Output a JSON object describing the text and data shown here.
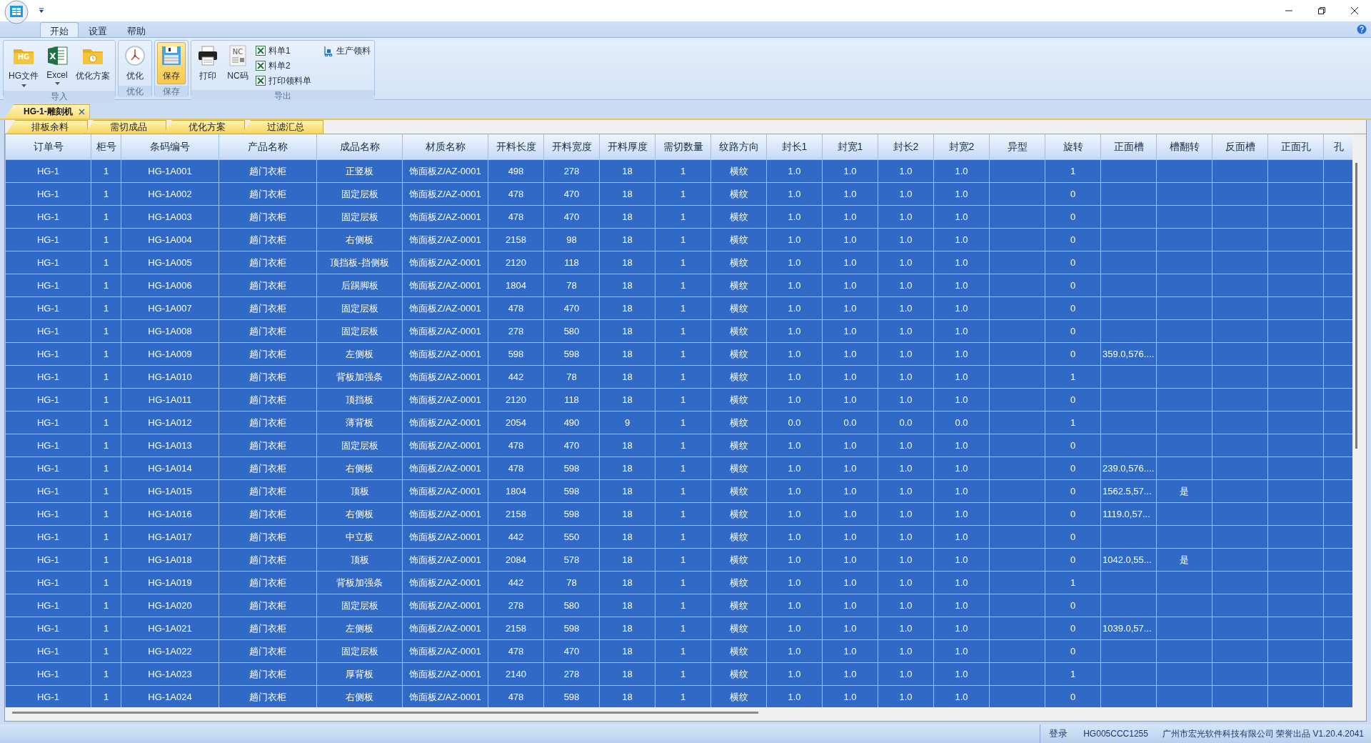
{
  "ribbon": {
    "tabs": [
      {
        "label": "开始",
        "selected": true
      },
      {
        "label": "设置",
        "selected": false
      },
      {
        "label": "帮助",
        "selected": false
      }
    ],
    "groups": [
      {
        "label": "导入",
        "buttons": [
          {
            "label": "HG文件",
            "kind": "large",
            "icon_text": "HG",
            "dropdown": true
          },
          {
            "label": "Excel",
            "kind": "large",
            "icon_text": "X",
            "dropdown": true
          },
          {
            "label": "优化方案",
            "kind": "large",
            "dropdown": false
          }
        ]
      },
      {
        "label": "优化",
        "buttons": [
          {
            "label": "优化",
            "kind": "large",
            "dropdown": false
          }
        ]
      },
      {
        "label": "保存",
        "buttons": [
          {
            "label": "保存",
            "kind": "large",
            "dropdown": false,
            "highlighted": true
          }
        ]
      },
      {
        "label": "导出",
        "buttons": [
          {
            "label": "打印",
            "kind": "large",
            "dropdown": false
          },
          {
            "label": "NC码",
            "kind": "large",
            "icon_text": "NC",
            "dropdown": false
          },
          {
            "label": "料单1",
            "kind": "small"
          },
          {
            "label": "料单2",
            "kind": "small"
          },
          {
            "label": "打印领料单",
            "kind": "small"
          },
          {
            "label": "生产领料",
            "kind": "small"
          }
        ]
      }
    ]
  },
  "doc_tabs": [
    {
      "label": "HG-1-雕刻机",
      "selected": true
    }
  ],
  "sub_tabs": [
    "排板余料",
    "需切成品",
    "优化方案",
    "过滤汇总"
  ],
  "table": {
    "columns": [
      "订单号",
      "柜号",
      "条码编号",
      "产品名称",
      "成品名称",
      "材质名称",
      "开料长度",
      "开料宽度",
      "开料厚度",
      "需切数量",
      "纹路方向",
      "封长1",
      "封宽1",
      "封长2",
      "封宽2",
      "异型",
      "旋转",
      "正面槽",
      "槽翻转",
      "反面槽",
      "正面孔",
      "孔"
    ],
    "rows": [
      {
        "cells": [
          "HG-1",
          "1",
          "HG-1A001",
          "趟门衣柜",
          "正竖板",
          "饰面板Z/AZ-0001",
          "498",
          "278",
          "18",
          "1",
          "横纹",
          "1.0",
          "1.0",
          "1.0",
          "1.0"
        ],
        "rotation": "1"
      },
      {
        "cells": [
          "HG-1",
          "1",
          "HG-1A002",
          "趟门衣柜",
          "固定层板",
          "饰面板Z/AZ-0001",
          "478",
          "470",
          "18",
          "1",
          "横纹",
          "1.0",
          "1.0",
          "1.0",
          "1.0"
        ],
        "rotation": "0"
      },
      {
        "cells": [
          "HG-1",
          "1",
          "HG-1A003",
          "趟门衣柜",
          "固定层板",
          "饰面板Z/AZ-0001",
          "478",
          "470",
          "18",
          "1",
          "横纹",
          "1.0",
          "1.0",
          "1.0",
          "1.0"
        ],
        "rotation": "0"
      },
      {
        "cells": [
          "HG-1",
          "1",
          "HG-1A004",
          "趟门衣柜",
          "右侧板",
          "饰面板Z/AZ-0001",
          "2158",
          "98",
          "18",
          "1",
          "横纹",
          "1.0",
          "1.0",
          "1.0",
          "1.0"
        ],
        "rotation": "0"
      },
      {
        "cells": [
          "HG-1",
          "1",
          "HG-1A005",
          "趟门衣柜",
          "顶挡板-挡侧板",
          "饰面板Z/AZ-0001",
          "2120",
          "118",
          "18",
          "1",
          "横纹",
          "1.0",
          "1.0",
          "1.0",
          "1.0"
        ],
        "rotation": "0"
      },
      {
        "cells": [
          "HG-1",
          "1",
          "HG-1A006",
          "趟门衣柜",
          "后踢脚板",
          "饰面板Z/AZ-0001",
          "1804",
          "78",
          "18",
          "1",
          "横纹",
          "1.0",
          "1.0",
          "1.0",
          "1.0"
        ],
        "rotation": "0"
      },
      {
        "cells": [
          "HG-1",
          "1",
          "HG-1A007",
          "趟门衣柜",
          "固定层板",
          "饰面板Z/AZ-0001",
          "478",
          "470",
          "18",
          "1",
          "横纹",
          "1.0",
          "1.0",
          "1.0",
          "1.0"
        ],
        "rotation": "0"
      },
      {
        "cells": [
          "HG-1",
          "1",
          "HG-1A008",
          "趟门衣柜",
          "固定层板",
          "饰面板Z/AZ-0001",
          "278",
          "580",
          "18",
          "1",
          "横纹",
          "1.0",
          "1.0",
          "1.0",
          "1.0"
        ],
        "rotation": "0"
      },
      {
        "cells": [
          "HG-1",
          "1",
          "HG-1A009",
          "趟门衣柜",
          "左侧板",
          "饰面板Z/AZ-0001",
          "598",
          "598",
          "18",
          "1",
          "横纹",
          "1.0",
          "1.0",
          "1.0",
          "1.0"
        ],
        "rotation": "0",
        "front_groove": "359.0,576...."
      },
      {
        "cells": [
          "HG-1",
          "1",
          "HG-1A010",
          "趟门衣柜",
          "背板加强条",
          "饰面板Z/AZ-0001",
          "442",
          "78",
          "18",
          "1",
          "横纹",
          "1.0",
          "1.0",
          "1.0",
          "1.0"
        ],
        "rotation": "1"
      },
      {
        "cells": [
          "HG-1",
          "1",
          "HG-1A011",
          "趟门衣柜",
          "顶挡板",
          "饰面板Z/AZ-0001",
          "2120",
          "118",
          "18",
          "1",
          "横纹",
          "1.0",
          "1.0",
          "1.0",
          "1.0"
        ],
        "rotation": "0"
      },
      {
        "cells": [
          "HG-1",
          "1",
          "HG-1A012",
          "趟门衣柜",
          "薄背板",
          "饰面板Z/AZ-0001",
          "2054",
          "490",
          "9",
          "1",
          "横纹",
          "0.0",
          "0.0",
          "0.0",
          "0.0"
        ],
        "rotation": "1"
      },
      {
        "cells": [
          "HG-1",
          "1",
          "HG-1A013",
          "趟门衣柜",
          "固定层板",
          "饰面板Z/AZ-0001",
          "478",
          "470",
          "18",
          "1",
          "横纹",
          "1.0",
          "1.0",
          "1.0",
          "1.0"
        ],
        "rotation": "0"
      },
      {
        "cells": [
          "HG-1",
          "1",
          "HG-1A014",
          "趟门衣柜",
          "右侧板",
          "饰面板Z/AZ-0001",
          "478",
          "598",
          "18",
          "1",
          "横纹",
          "1.0",
          "1.0",
          "1.0",
          "1.0"
        ],
        "rotation": "0",
        "front_groove": "239.0,576...."
      },
      {
        "cells": [
          "HG-1",
          "1",
          "HG-1A015",
          "趟门衣柜",
          "顶板",
          "饰面板Z/AZ-0001",
          "1804",
          "598",
          "18",
          "1",
          "横纹",
          "1.0",
          "1.0",
          "1.0",
          "1.0"
        ],
        "rotation": "0",
        "front_groove": "1562.5,57...",
        "groove_flip": "是"
      },
      {
        "cells": [
          "HG-1",
          "1",
          "HG-1A016",
          "趟门衣柜",
          "右侧板",
          "饰面板Z/AZ-0001",
          "2158",
          "598",
          "18",
          "1",
          "横纹",
          "1.0",
          "1.0",
          "1.0",
          "1.0"
        ],
        "rotation": "0",
        "front_groove": "1119.0,57..."
      },
      {
        "cells": [
          "HG-1",
          "1",
          "HG-1A017",
          "趟门衣柜",
          "中立板",
          "饰面板Z/AZ-0001",
          "442",
          "550",
          "18",
          "1",
          "横纹",
          "1.0",
          "1.0",
          "1.0",
          "1.0"
        ],
        "rotation": "0"
      },
      {
        "cells": [
          "HG-1",
          "1",
          "HG-1A018",
          "趟门衣柜",
          "顶板",
          "饰面板Z/AZ-0001",
          "2084",
          "578",
          "18",
          "1",
          "横纹",
          "1.0",
          "1.0",
          "1.0",
          "1.0"
        ],
        "rotation": "0",
        "front_groove": "1042.0,55...",
        "groove_flip": "是"
      },
      {
        "cells": [
          "HG-1",
          "1",
          "HG-1A019",
          "趟门衣柜",
          "背板加强条",
          "饰面板Z/AZ-0001",
          "442",
          "78",
          "18",
          "1",
          "横纹",
          "1.0",
          "1.0",
          "1.0",
          "1.0"
        ],
        "rotation": "1"
      },
      {
        "cells": [
          "HG-1",
          "1",
          "HG-1A020",
          "趟门衣柜",
          "固定层板",
          "饰面板Z/AZ-0001",
          "278",
          "580",
          "18",
          "1",
          "横纹",
          "1.0",
          "1.0",
          "1.0",
          "1.0"
        ],
        "rotation": "0"
      },
      {
        "cells": [
          "HG-1",
          "1",
          "HG-1A021",
          "趟门衣柜",
          "左侧板",
          "饰面板Z/AZ-0001",
          "2158",
          "598",
          "18",
          "1",
          "横纹",
          "1.0",
          "1.0",
          "1.0",
          "1.0"
        ],
        "rotation": "0",
        "front_groove": "1039.0,57..."
      },
      {
        "cells": [
          "HG-1",
          "1",
          "HG-1A022",
          "趟门衣柜",
          "固定层板",
          "饰面板Z/AZ-0001",
          "478",
          "470",
          "18",
          "1",
          "横纹",
          "1.0",
          "1.0",
          "1.0",
          "1.0"
        ],
        "rotation": "0"
      },
      {
        "cells": [
          "HG-1",
          "1",
          "HG-1A023",
          "趟门衣柜",
          "厚背板",
          "饰面板Z/AZ-0001",
          "2140",
          "278",
          "18",
          "1",
          "横纹",
          "1.0",
          "1.0",
          "1.0",
          "1.0"
        ],
        "rotation": "1"
      },
      {
        "cells": [
          "HG-1",
          "1",
          "HG-1A024",
          "趟门衣柜",
          "右侧板",
          "饰面板Z/AZ-0001",
          "478",
          "598",
          "18",
          "1",
          "横纹",
          "1.0",
          "1.0",
          "1.0",
          "1.0"
        ],
        "rotation": "0"
      }
    ]
  },
  "status_bar": {
    "login": "登录",
    "machine_code": "HG005CCC1255",
    "credit": "广州市宏光软件科技有限公司 荣誉出品 V1.20.4.2041"
  }
}
